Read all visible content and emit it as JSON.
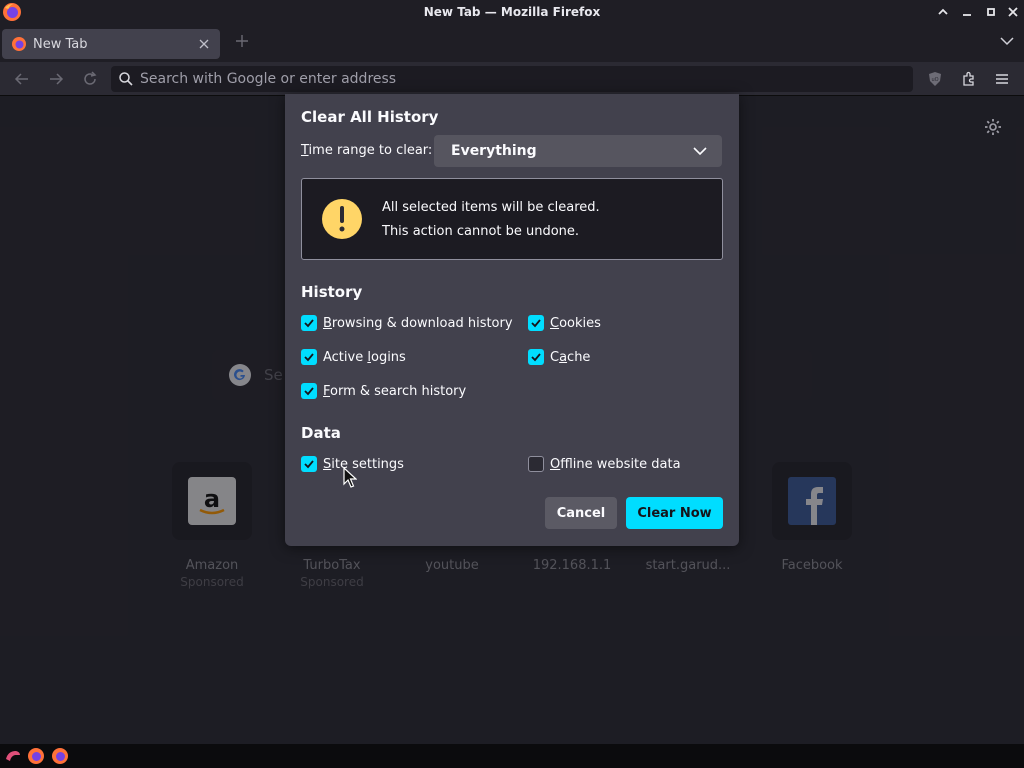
{
  "window": {
    "title": "New Tab — Mozilla Firefox"
  },
  "tabs": [
    {
      "label": "New Tab",
      "active": true
    }
  ],
  "urlbar": {
    "placeholder": "Search with Google or enter address"
  },
  "page": {
    "search_placeholder": "Se",
    "tiles": [
      {
        "title": "Amazon",
        "sponsor": "Sponsored"
      },
      {
        "title": "TurboTax",
        "sponsor": "Sponsored"
      },
      {
        "title": "youtube",
        "sponsor": ""
      },
      {
        "title": "192.168.1.1",
        "sponsor": ""
      },
      {
        "title": "start.garud...",
        "sponsor": ""
      },
      {
        "title": "Facebook",
        "sponsor": ""
      }
    ]
  },
  "dialog": {
    "title": "Clear All History",
    "time_range_label_access": "T",
    "time_range_label_rest": "ime range to clear:",
    "time_range_value": "Everything",
    "warning_line1": "All selected items will be cleared.",
    "warning_line2": "This action cannot be undone.",
    "history_heading": "History",
    "data_heading": "Data",
    "history_items": [
      {
        "access": "B",
        "rest": "rowsing & download history",
        "checked": true
      },
      {
        "access": "C",
        "rest": "ookies",
        "checked": true
      },
      {
        "pre": "Active ",
        "access": "l",
        "rest": "ogins",
        "checked": true
      },
      {
        "pre": "C",
        "access": "a",
        "rest": "che",
        "checked": true
      },
      {
        "access": "F",
        "rest": "orm & search history",
        "checked": true
      }
    ],
    "data_items": [
      {
        "pre": "",
        "access": "S",
        "rest": "ite settings",
        "checked": true
      },
      {
        "pre": "",
        "access": "O",
        "rest": "ffline website data",
        "checked": false
      }
    ],
    "cancel_label": "Cancel",
    "clear_label": "Clear Now"
  },
  "colors": {
    "accent": "#00ddff",
    "dialog_bg": "#42414d",
    "warning": "#ffd567"
  }
}
